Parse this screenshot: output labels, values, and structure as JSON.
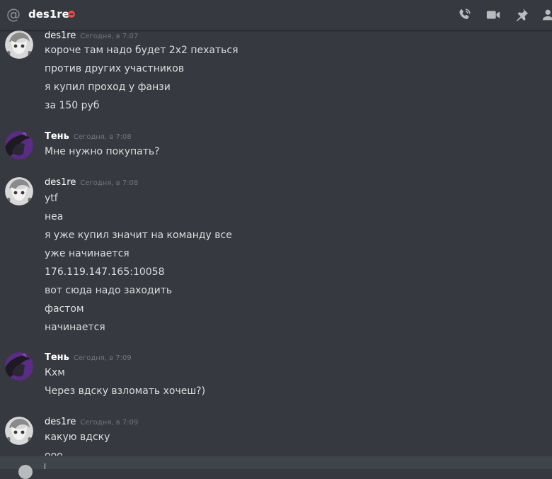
{
  "header": {
    "title": "des1re",
    "status_color": "#f04747"
  },
  "groups": [
    {
      "author": "des1re",
      "timestamp": "Сегодня, в 7:07",
      "avatar": "anime-avatar",
      "lines": [
        "короче там надо будет 2х2 пехаться",
        "против других участников",
        "я купил проход у фанзи",
        "за 150 руб"
      ]
    },
    {
      "author": "Тень",
      "timestamp": "Сегодня, в 7:08",
      "avatar": "shadow-avatar",
      "lines": [
        "Мне нужно покупать?"
      ]
    },
    {
      "author": "des1re",
      "timestamp": "Сегодня, в 7:08",
      "avatar": "anime-avatar",
      "lines": [
        "ytf",
        "неа",
        "я уже купил значит на команду все",
        "уже начинается",
        "176.119.147.165:10058",
        "вот сюда надо заходить",
        "фастом",
        "начинается"
      ]
    },
    {
      "author": "Тень",
      "timestamp": "Сегодня, в 7:09",
      "avatar": "shadow-avatar",
      "lines": [
        "Кхм",
        "Через вдску взломать хочеш?)"
      ]
    },
    {
      "author": "des1re",
      "timestamp": "Сегодня, в 7:09",
      "avatar": "anime-avatar",
      "lines": [
        "какую вдску",
        "ооо"
      ]
    }
  ]
}
